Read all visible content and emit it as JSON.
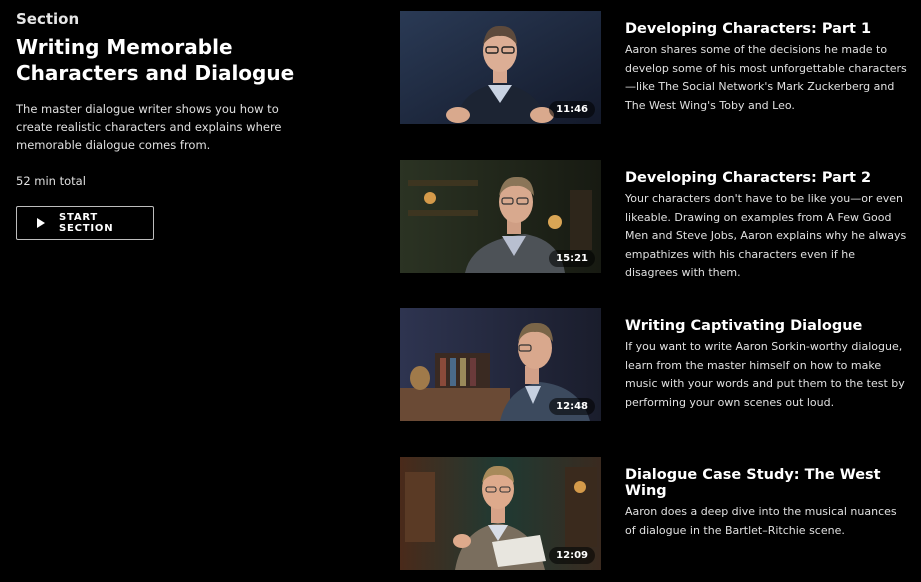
{
  "section": {
    "eyebrow": "Section",
    "title": "Writing Memorable Characters and Dialogue",
    "description": "The master dialogue writer shows you how to create realistic characters and explains where memorable dialogue comes from.",
    "total": "52 min total",
    "start_label": "START SECTION"
  },
  "lessons": [
    {
      "title": "Developing Characters: Part 1",
      "description": "Aaron shares some of the decisions he made to develop some of his most unforgettable characters—like The Social Network's Mark Zuckerberg and The West Wing's Toby and Leo.",
      "duration": "11:46"
    },
    {
      "title": "Developing Characters: Part 2",
      "description": "Your characters don't have to be like you—or even likeable. Drawing on examples from A Few Good Men and Steve Jobs, Aaron explains why he always empathizes with his characters even if he disagrees with them.",
      "duration": "15:21"
    },
    {
      "title": "Writing Captivating Dialogue",
      "description": "If you want to write Aaron Sorkin-worthy dialogue, learn from the master himself on how to make music with your words and put them to the test by performing your own scenes out loud.",
      "duration": "12:48"
    },
    {
      "title": "Dialogue Case Study: The West Wing",
      "description": "Aaron does a deep dive into the musical nuances of dialogue in the Bartlet–Ritchie scene.",
      "duration": "12:09"
    }
  ],
  "colors": {
    "background": "#000000",
    "text": "#ffffff",
    "muted_text": "#e0e0e0",
    "button_border": "#bdbdbd"
  }
}
